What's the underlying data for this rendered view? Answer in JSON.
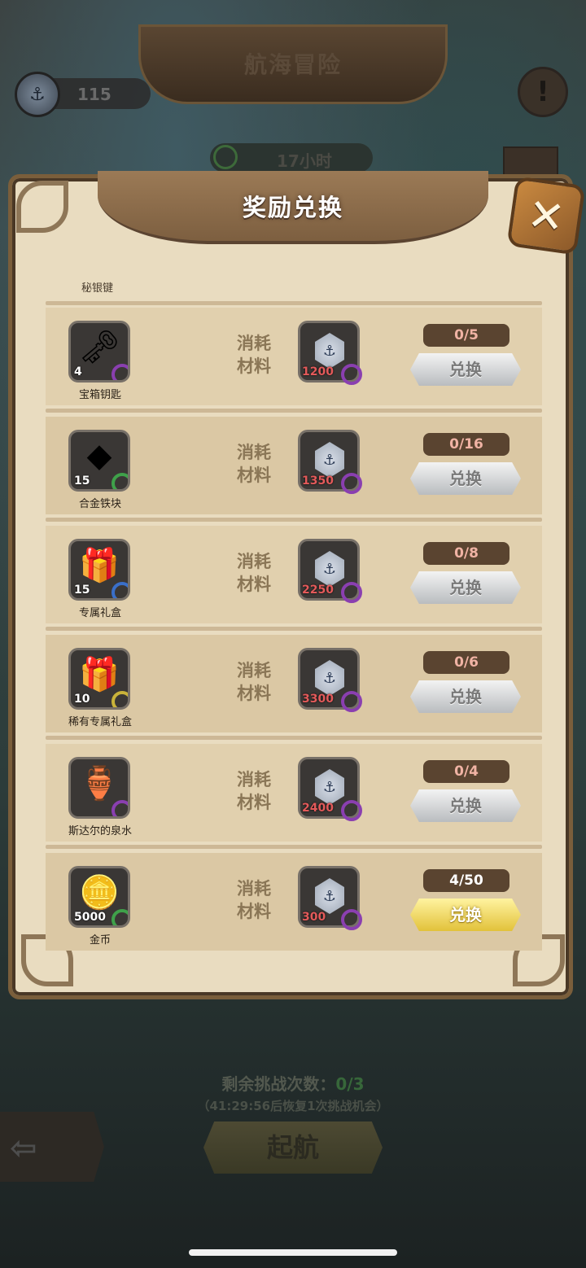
{
  "background": {
    "title": "航海冒险",
    "currency_value": "115",
    "timer": "17小时",
    "info_symbol": "!"
  },
  "modal": {
    "title": "奖励兑换",
    "close_symbol": "✕",
    "section_label": "秘银键",
    "cost_label_line1": "消耗",
    "cost_label_line2": "材料",
    "exchange_label": "兑换",
    "rows": [
      {
        "name": "宝箱钥匙",
        "qty": "4",
        "icon": "key-icon",
        "glyph": "🗝",
        "rarity": "#8a3fb0",
        "cost": "1200",
        "counter": "0/5",
        "button": "silver"
      },
      {
        "name": "合金铁块",
        "qty": "15",
        "icon": "ingot-icon",
        "glyph": "◆",
        "rarity": "#3fa14a",
        "cost": "1350",
        "counter": "0/16",
        "button": "silver"
      },
      {
        "name": "专属礼盒",
        "qty": "15",
        "icon": "gift-box-icon",
        "glyph": "🎁",
        "rarity": "#3a6fc9",
        "cost": "2250",
        "counter": "0/8",
        "button": "silver"
      },
      {
        "name": "稀有专属礼盒",
        "qty": "10",
        "icon": "rare-gift-box-icon",
        "glyph": "🎁",
        "rarity": "#c9b33a",
        "cost": "3300",
        "counter": "0/6",
        "button": "silver"
      },
      {
        "name": "斯达尔的泉水",
        "qty": "",
        "icon": "lamp-icon",
        "glyph": "🏺",
        "rarity": "#8a3fb0",
        "cost": "2400",
        "counter": "0/4",
        "button": "silver"
      },
      {
        "name": "金币",
        "qty": "5000",
        "icon": "gold-coin-icon",
        "glyph": "🪙",
        "rarity": "#3fa14a",
        "cost": "300",
        "counter": "4/50",
        "button": "gold"
      }
    ]
  },
  "footer": {
    "remaining_label": "剩余挑战次数：",
    "remaining_value": "0/3",
    "recover_text": "（41:29:56后恢复1次挑战机会）",
    "sail_label": "起航",
    "back_symbol": "⇦"
  },
  "colors": {
    "accent_brown": "#7a5e3b",
    "parchment": "#e9dcc0",
    "counter_bg": "#5a4430"
  }
}
